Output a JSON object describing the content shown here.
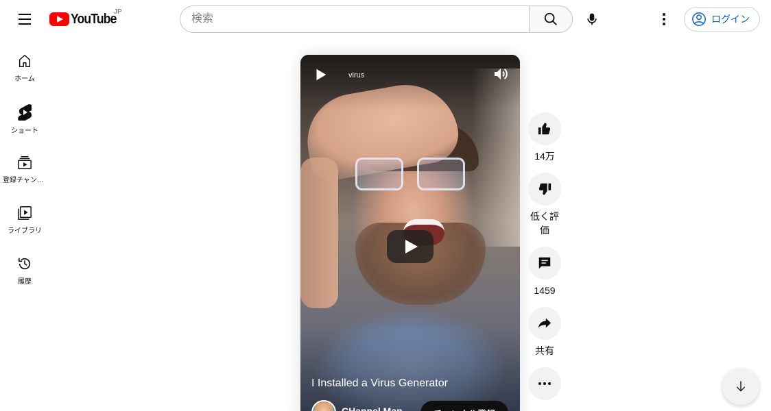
{
  "header": {
    "logo_text": "YouTube",
    "region": "JP",
    "search_placeholder": "検索",
    "login_label": "ログイン"
  },
  "sidebar": {
    "items": [
      {
        "label": "ホーム",
        "icon": "home-icon"
      },
      {
        "label": "ショート",
        "icon": "shorts-icon"
      },
      {
        "label": "登録チャンネル",
        "icon": "subscriptions-icon"
      },
      {
        "label": "ライブラリ",
        "icon": "library-icon"
      },
      {
        "label": "履歴",
        "icon": "history-icon"
      }
    ]
  },
  "player": {
    "top_label": "virus",
    "title": "I Installed a Virus Generator",
    "channel": "CHannel Man",
    "subscribe_label": "チャンネル登録"
  },
  "actions": {
    "like_count": "14万",
    "dislike_label": "低く評価",
    "comment_count": "1459",
    "share_label": "共有"
  },
  "colors": {
    "brand_red": "#ff0000",
    "link_blue": "#065fd4",
    "button_gray": "#f2f2f2"
  }
}
